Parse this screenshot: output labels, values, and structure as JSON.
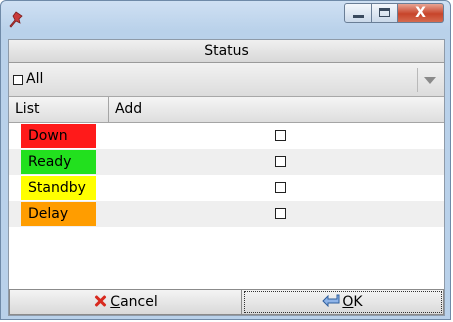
{
  "window": {
    "title": "",
    "close_glyph": "X"
  },
  "header": {
    "title": "Status"
  },
  "filter": {
    "checkbox_label": "All",
    "checked": false
  },
  "table": {
    "columns": [
      "List",
      "Add"
    ],
    "rows": [
      {
        "label": "Down",
        "color": "#ff1a1a",
        "checked": false
      },
      {
        "label": "Ready",
        "color": "#22e01e",
        "checked": false
      },
      {
        "label": "Standby",
        "color": "#ffff00",
        "checked": false
      },
      {
        "label": "Delay",
        "color": "#ff9d00",
        "checked": false
      }
    ]
  },
  "footer": {
    "cancel_mnemonic": "C",
    "cancel_rest": "ancel",
    "ok_mnemonic": "O",
    "ok_rest": "K"
  }
}
